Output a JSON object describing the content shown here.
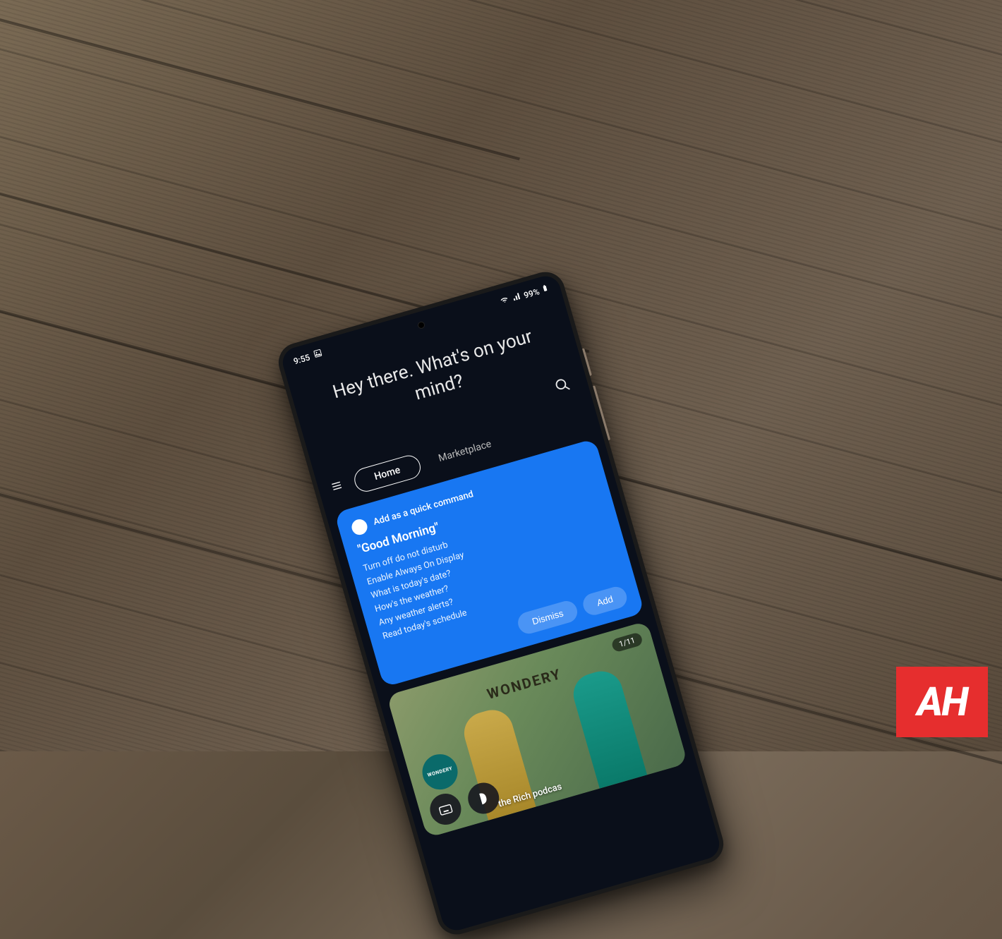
{
  "status_bar": {
    "time": "9:55",
    "battery_percent": "99%",
    "icons": [
      "picture-icon",
      "wifi-icon",
      "signal-icon",
      "battery-icon"
    ]
  },
  "greeting": "Hey there. What's on your mind?",
  "tabs": {
    "active": "Home",
    "inactive": "Marketplace"
  },
  "quick_command_card": {
    "label": "Add as a quick command",
    "title": "\"Good Morning\"",
    "items": [
      "Turn off do not disturb",
      "Enable Always On Display",
      "What is today's date?",
      "How's the weather?",
      "Any weather alerts?",
      "Read today's schedule"
    ],
    "dismiss_label": "Dismiss",
    "add_label": "Add"
  },
  "media_card": {
    "brand": "WONDERY",
    "badge": "WONDERY",
    "counter": "1/11",
    "caption": "the Rich podcas"
  },
  "watermark": "AH"
}
